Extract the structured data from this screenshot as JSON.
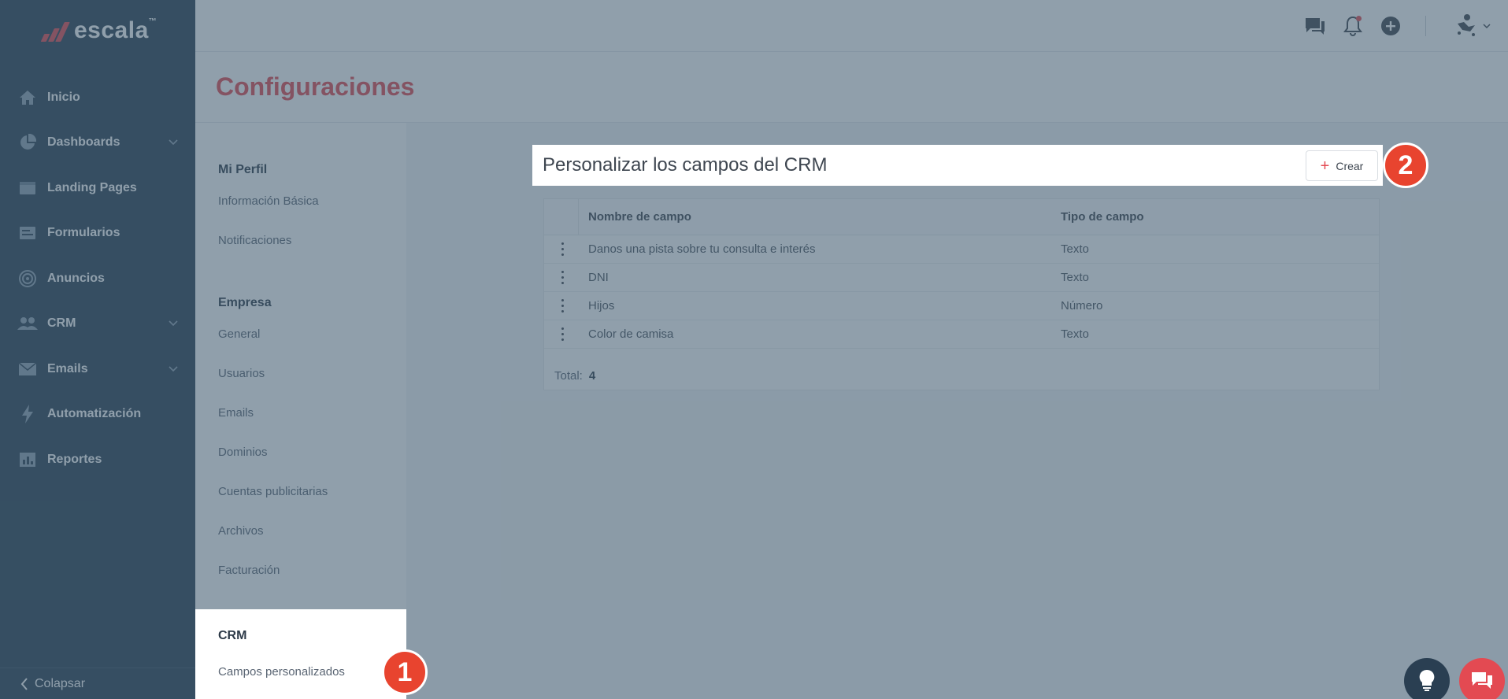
{
  "app": {
    "logo_text": "escala",
    "logo_mark": "™"
  },
  "sidebar": {
    "items": [
      {
        "label": "Inicio",
        "icon": "home-icon",
        "has_children": false
      },
      {
        "label": "Dashboards",
        "icon": "pie-chart-icon",
        "has_children": true
      },
      {
        "label": "Landing Pages",
        "icon": "browser-window-icon",
        "has_children": false
      },
      {
        "label": "Formularios",
        "icon": "form-icon",
        "has_children": false
      },
      {
        "label": "Anuncios",
        "icon": "target-icon",
        "has_children": false
      },
      {
        "label": "CRM",
        "icon": "people-icon",
        "has_children": true
      },
      {
        "label": "Emails",
        "icon": "envelope-icon",
        "has_children": true
      },
      {
        "label": "Automatización",
        "icon": "lightning-icon",
        "has_children": false
      },
      {
        "label": "Reportes",
        "icon": "bar-chart-icon",
        "has_children": false
      }
    ],
    "collapse_label": "Colapsar"
  },
  "topbar": {
    "icons": [
      "chat-bubbles-icon",
      "bell-icon",
      "add-circle-icon",
      "user-avatar-icon"
    ]
  },
  "page": {
    "title": "Configuraciones"
  },
  "settings_menu": {
    "profile": {
      "heading": "Mi Perfil",
      "items": [
        "Información Básica",
        "Notificaciones"
      ]
    },
    "company": {
      "heading": "Empresa",
      "items": [
        "General",
        "Usuarios",
        "Emails",
        "Dominios",
        "Cuentas publicitarias",
        "Archivos",
        "Facturación"
      ]
    },
    "crm": {
      "heading": "CRM",
      "items": [
        "Campos personalizados"
      ]
    }
  },
  "main": {
    "card_title": "Personalizar los campos del CRM",
    "create_button": "Crear",
    "table": {
      "columns": [
        "Nombre de campo",
        "Tipo de campo"
      ],
      "rows": [
        [
          "Danos una pista sobre tu consulta e interés",
          "Texto"
        ],
        [
          "DNI",
          "Texto"
        ],
        [
          "Hijos",
          "Número"
        ],
        [
          "Color de camisa",
          "Texto"
        ]
      ]
    },
    "total_label": "Total:",
    "total_value": "4"
  },
  "annotations": {
    "step1": "1",
    "step2": "2"
  },
  "colors": {
    "brand_red": "#e34a52",
    "sidebar_bg": "#2a3f52",
    "badge_red": "#e8442f"
  }
}
